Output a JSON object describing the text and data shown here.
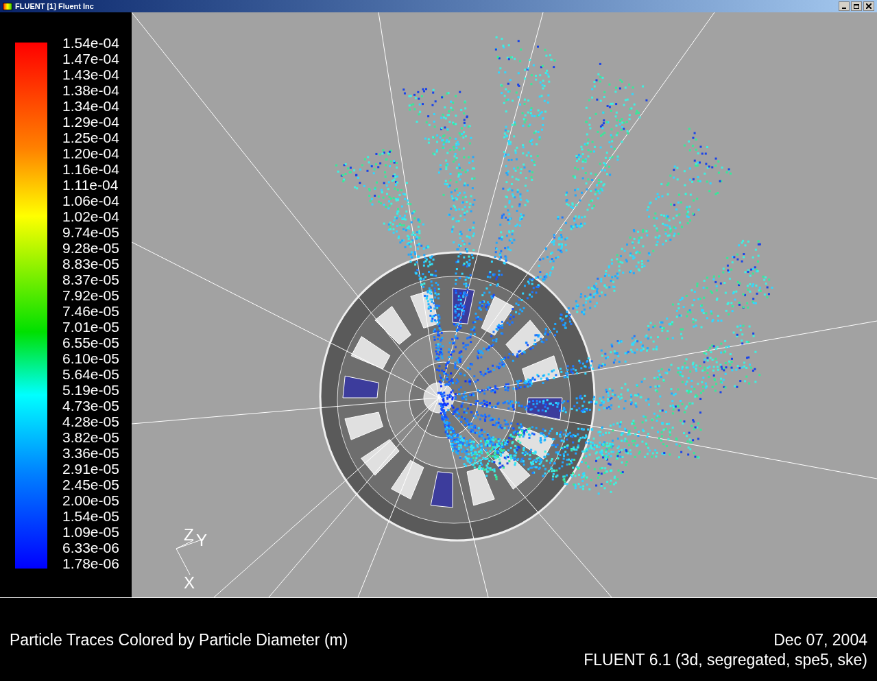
{
  "window": {
    "title": "FLUENT [1] Fluent Inc"
  },
  "legend": {
    "labels": [
      "1.54e-04",
      "1.47e-04",
      "1.43e-04",
      "1.38e-04",
      "1.34e-04",
      "1.29e-04",
      "1.25e-04",
      "1.20e-04",
      "1.16e-04",
      "1.11e-04",
      "1.06e-04",
      "1.02e-04",
      "9.74e-05",
      "9.28e-05",
      "8.83e-05",
      "8.37e-05",
      "7.92e-05",
      "7.46e-05",
      "7.01e-05",
      "6.55e-05",
      "6.10e-05",
      "5.64e-05",
      "5.19e-05",
      "4.73e-05",
      "4.28e-05",
      "3.82e-05",
      "3.36e-05",
      "2.91e-05",
      "2.45e-05",
      "2.00e-05",
      "1.54e-05",
      "1.09e-05",
      "6.33e-06",
      "1.78e-06"
    ]
  },
  "axes": {
    "z": "Z",
    "y": "Y",
    "x": "X"
  },
  "footer": {
    "title": "Particle Traces Colored by Particle Diameter (m)",
    "date": "Dec 07, 2004",
    "version": "FLUENT 6.1 (3d, segregated, spe5, ske)"
  }
}
